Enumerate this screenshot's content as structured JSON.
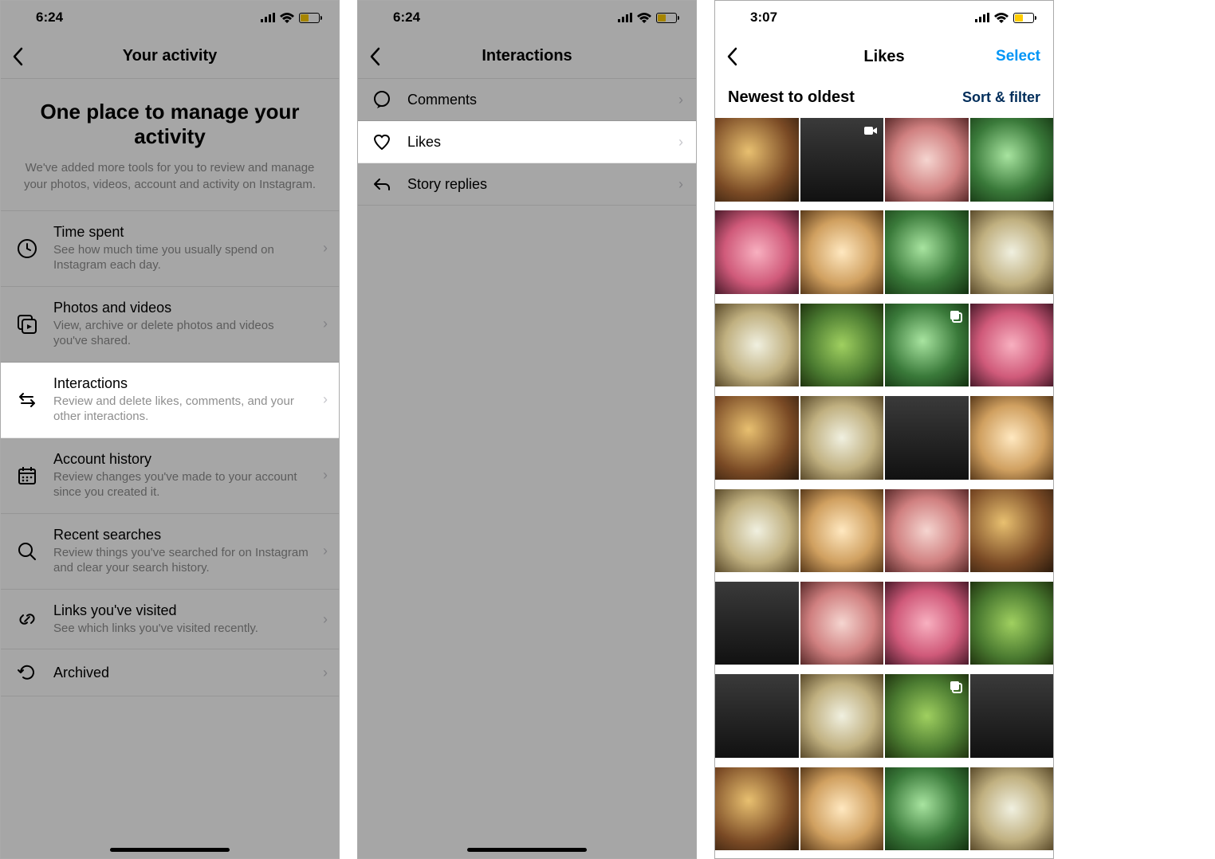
{
  "screens": [
    {
      "status": {
        "time": "6:24"
      },
      "nav": {
        "title": "Your activity"
      },
      "hero": {
        "title": "One place to manage your activity",
        "subtitle": "We've added more tools for you to review and manage your photos, videos, account and activity on Instagram."
      },
      "menu": [
        {
          "icon": "clock",
          "title": "Time spent",
          "sub": "See how much time you usually spend on Instagram each day."
        },
        {
          "icon": "media",
          "title": "Photos and videos",
          "sub": "View, archive or delete photos and videos you've shared."
        },
        {
          "icon": "swap",
          "title": "Interactions",
          "sub": "Review and delete likes, comments, and your other interactions.",
          "highlight": true
        },
        {
          "icon": "calendar",
          "title": "Account history",
          "sub": "Review changes you've made to your account since you created it."
        },
        {
          "icon": "search",
          "title": "Recent searches",
          "sub": "Review things you've searched for on Instagram and clear your search history."
        },
        {
          "icon": "link",
          "title": "Links you've visited",
          "sub": "See which links you've visited recently."
        },
        {
          "icon": "undo",
          "title": "Archived",
          "sub": ""
        }
      ]
    },
    {
      "status": {
        "time": "6:24"
      },
      "nav": {
        "title": "Interactions"
      },
      "rows": [
        {
          "icon": "comment",
          "label": "Comments"
        },
        {
          "icon": "heart",
          "label": "Likes",
          "highlight": true
        },
        {
          "icon": "reply",
          "label": "Story replies"
        }
      ]
    },
    {
      "status": {
        "time": "3:07"
      },
      "nav": {
        "title": "Likes",
        "action": "Select"
      },
      "filter": {
        "sort_label": "Newest to oldest",
        "filter_label": "Sort & filter"
      },
      "grid_count": 32,
      "thumbs": [
        {
          "c": "a"
        },
        {
          "c": "f",
          "badge": "video"
        },
        {
          "c": "c"
        },
        {
          "c": "e"
        },
        {
          "c": "h"
        },
        {
          "c": "g"
        },
        {
          "c": "e"
        },
        {
          "c": "d"
        },
        {
          "c": "d"
        },
        {
          "c": "b"
        },
        {
          "c": "e",
          "badge": "multi"
        },
        {
          "c": "h"
        },
        {
          "c": "a"
        },
        {
          "c": "d"
        },
        {
          "c": "f"
        },
        {
          "c": "g"
        },
        {
          "c": "d"
        },
        {
          "c": "g"
        },
        {
          "c": "c"
        },
        {
          "c": "a"
        },
        {
          "c": "f"
        },
        {
          "c": "c"
        },
        {
          "c": "h"
        },
        {
          "c": "b"
        },
        {
          "c": "f"
        },
        {
          "c": "d"
        },
        {
          "c": "b",
          "badge": "multi"
        },
        {
          "c": "f"
        },
        {
          "c": "a"
        },
        {
          "c": "g"
        },
        {
          "c": "e"
        },
        {
          "c": "d"
        }
      ]
    }
  ]
}
